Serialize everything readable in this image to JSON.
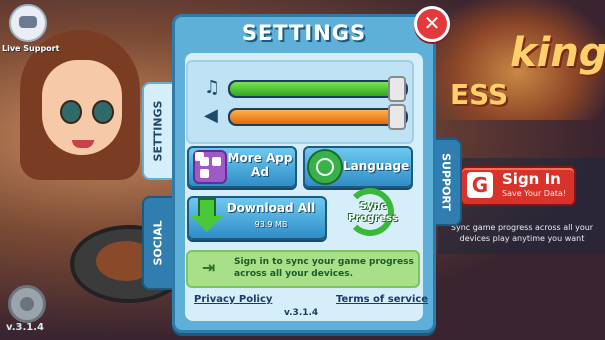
{
  "side": {
    "live_support": "Live Support",
    "version": "v.3.1.4"
  },
  "dialog": {
    "title": "SETTINGS",
    "tabs": {
      "settings": "SETTINGS",
      "social": "SOCIAL",
      "support": "SUPPORT"
    },
    "music_volume": 0.97,
    "sound_volume": 0.97,
    "more_app_ad": "More App Ad",
    "language": "Language",
    "download_all": "Download All",
    "download_size": "93.9 MB",
    "sync_progress": "Sync Progress",
    "sign_in_info": "Sign in to sync your game progress across all your devices.",
    "privacy_policy": "Privacy Policy",
    "terms_of_service": "Terms of service",
    "version": "v.3.1.4"
  },
  "signin_panel": {
    "title": "Sign In",
    "subtitle": "Save Your Data!",
    "description": "Sync game progress across all your devices play anytime you want"
  },
  "background": {
    "text_1": "king",
    "text_2": "ESS"
  }
}
